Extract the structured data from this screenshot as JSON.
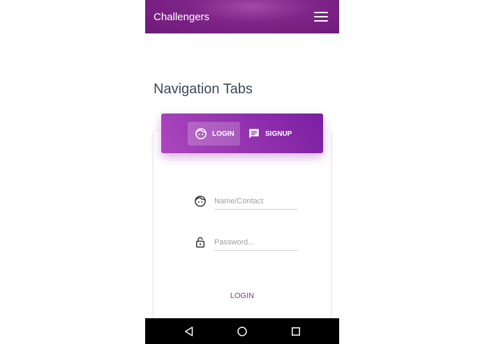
{
  "appbar": {
    "title": "Challengers",
    "menu_icon": "hamburger-menu-icon"
  },
  "page": {
    "heading": "Navigation Tabs"
  },
  "tabs": [
    {
      "label": "LOGIN",
      "icon": "face-icon",
      "active": true
    },
    {
      "label": "SIGNUP",
      "icon": "chat-icon",
      "active": false
    }
  ],
  "form": {
    "name_placeholder": "Name/Contact",
    "password_placeholder": "Password...",
    "submit_label": "LOGIN"
  },
  "colors": {
    "primary": "#9c27b0",
    "primary_dark": "#7b1fa2",
    "appbar": "#7f2589"
  },
  "navbar": {
    "icons": [
      "back-triangle-icon",
      "home-circle-icon",
      "recent-square-icon"
    ]
  }
}
